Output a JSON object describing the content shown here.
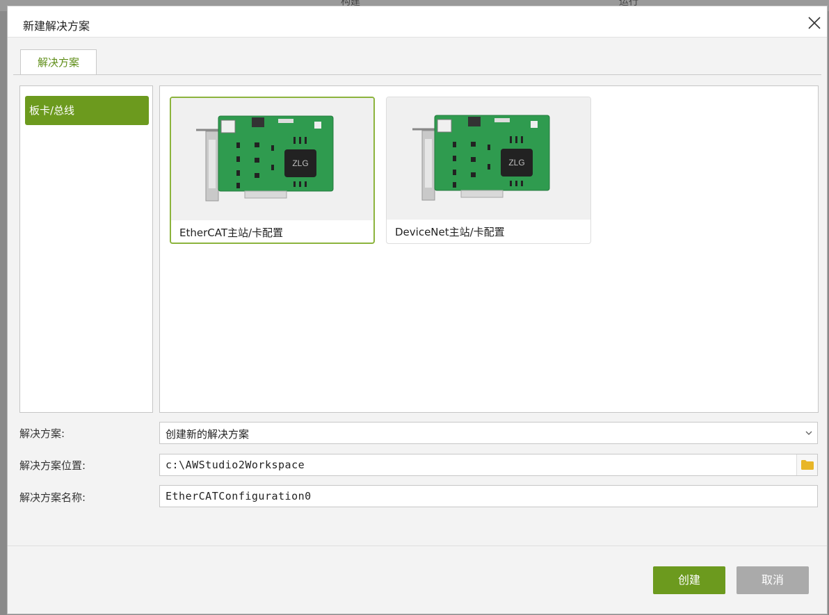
{
  "background": {
    "partial_texts": [
      "构建",
      "运行"
    ]
  },
  "dialog": {
    "title": "新建解决方案"
  },
  "tabs": [
    {
      "label": "解决方案",
      "active": true
    }
  ],
  "categories": [
    {
      "label": "板卡/总线",
      "selected": true
    }
  ],
  "templates": [
    {
      "label": "EtherCAT主站/卡配置",
      "selected": true,
      "image": "pcie-card-zlg"
    },
    {
      "label": "DeviceNet主站/卡配置",
      "selected": false,
      "image": "pcie-card-zlg"
    }
  ],
  "chip_text": "ZLG",
  "form": {
    "solution_label": "解决方案:",
    "solution_value": "创建新的解决方案",
    "location_label": "解决方案位置:",
    "location_value": "c:\\AWStudio2Workspace",
    "name_label": "解决方案名称:",
    "name_value": "EtherCATConfiguration0"
  },
  "buttons": {
    "create": "创建",
    "cancel": "取消"
  },
  "colors": {
    "accent": "#6c9a1e",
    "selected_border": "#8bb33c",
    "disabled_button": "#aaaaaa",
    "folder": "#e8b628"
  }
}
